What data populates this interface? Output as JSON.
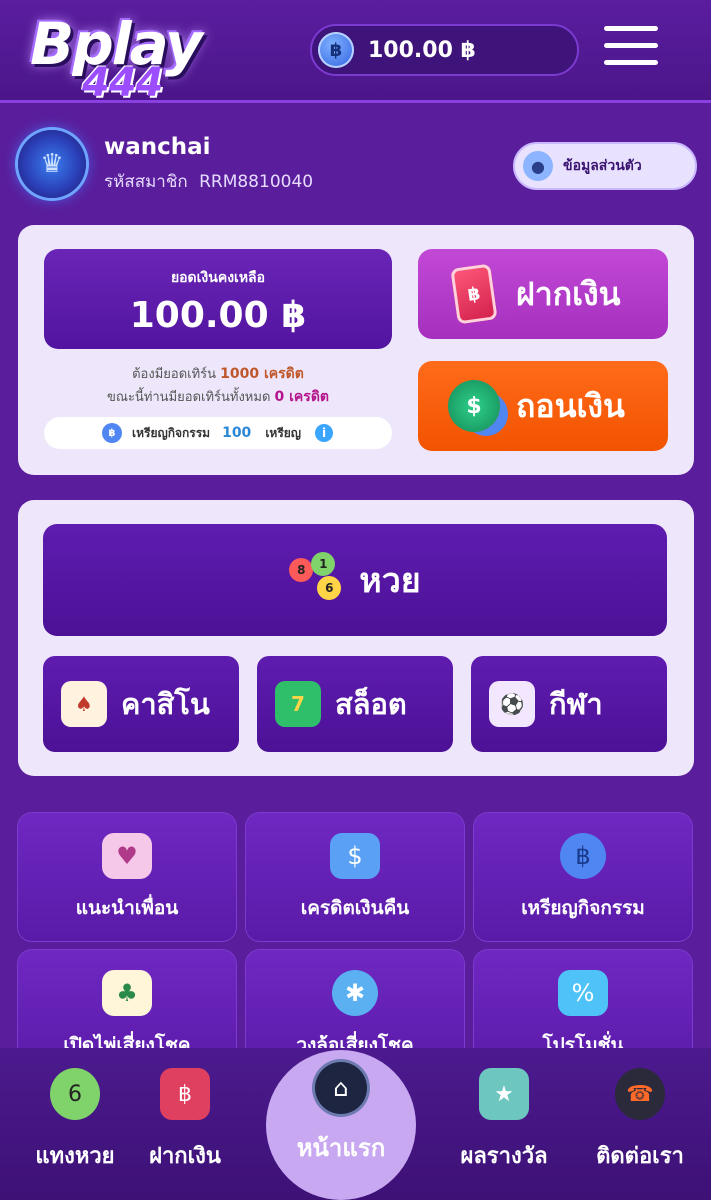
{
  "header": {
    "logo_main": "Bplay",
    "logo_num": "444",
    "balance": "100.00 ฿",
    "coin_symbol": "฿",
    "menu_icon": "hamburger-menu-icon"
  },
  "profile": {
    "username": "wanchai",
    "member_label": "รหัสสมาชิก",
    "member_id": "RRM8810040",
    "info_button": "ข้อมูลส่วนตัว"
  },
  "wallet": {
    "balance_label": "ยอดเงินคงเหลือ",
    "balance_value": "100.00 ฿",
    "turnover_required_prefix": "ต้องมียอดเทิร์น",
    "turnover_required_value": "1000 เครดิต",
    "turnover_current_prefix": "ขณะนี้ท่านมียอดเทิร์นทั้งหมด",
    "turnover_current_value": "0 เครดิต",
    "activity_coins_label": "เหรียญกิจกรรม",
    "activity_coins_value": "100",
    "activity_coins_unit": "เหรียญ",
    "deposit_label": "ฝากเงิน",
    "withdraw_label": "ถอนเงิน"
  },
  "games": {
    "lottery": "หวย",
    "casino": "คาสิโน",
    "slot": "สล็อต",
    "sport": "กีฬา"
  },
  "menu_grid": [
    {
      "label": "แนะนำเพื่อน",
      "icon": "friends-icon"
    },
    {
      "label": "เครดิตเงินคืน",
      "icon": "money-bag-icon"
    },
    {
      "label": "เหรียญกิจกรรม",
      "icon": "coin-icon"
    },
    {
      "label": "เปิดไพ่เสี่ยงโชค",
      "icon": "cards-icon"
    },
    {
      "label": "วงล้อเสี่ยงโชค",
      "icon": "wheel-icon"
    },
    {
      "label": "โปรโมชั่น",
      "icon": "gift-icon"
    }
  ],
  "bottom_nav": {
    "lottery": "แทงหวย",
    "deposit": "ฝากเงิน",
    "home": "หน้าแรก",
    "results": "ผลรางวัล",
    "contact": "ติดต่อเรา"
  },
  "colors": {
    "background": "#5a1e9c",
    "card": "#eee7fb",
    "deposit": "#b83ccf",
    "withdraw": "#f25300"
  }
}
